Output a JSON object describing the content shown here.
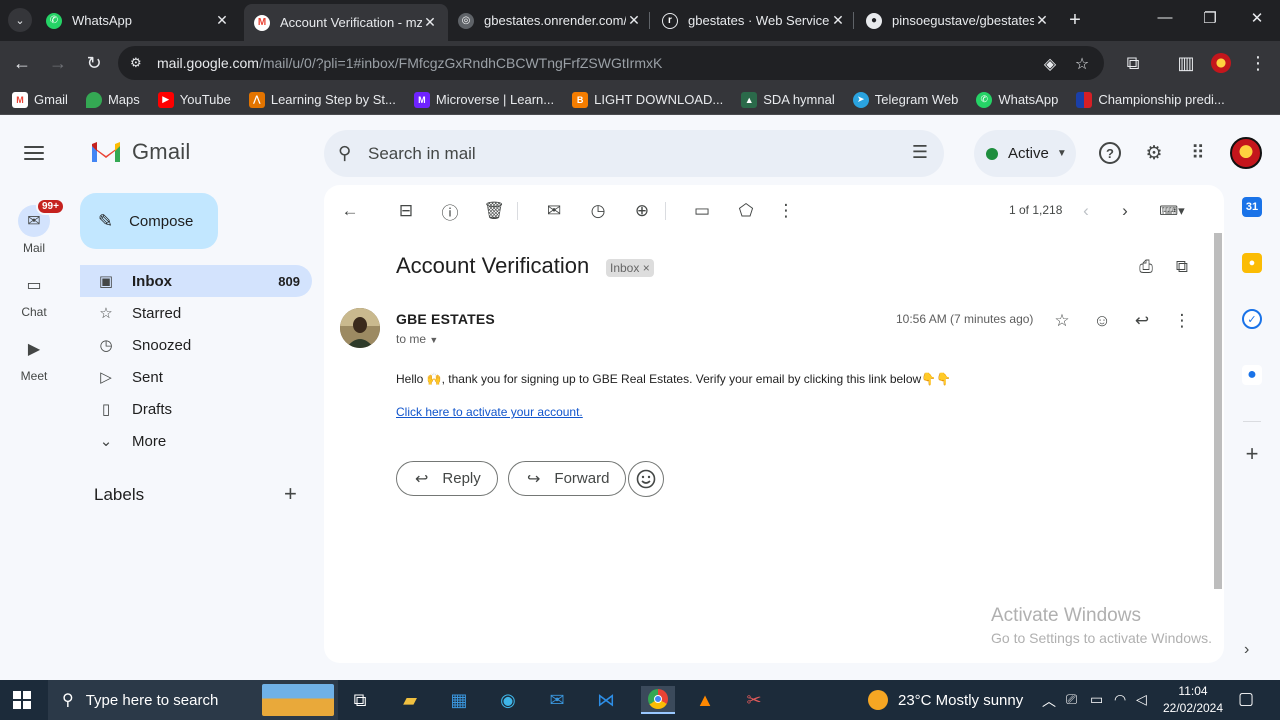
{
  "browser": {
    "tabs": [
      {
        "title": "WhatsApp",
        "favicon": "whatsapp-icon",
        "active": false
      },
      {
        "title": "Account Verification - mz",
        "favicon": "gmail-icon",
        "active": true
      },
      {
        "title": "gbestates.onrender.com/",
        "favicon": "globe-icon",
        "active": false
      },
      {
        "title": "gbestates · Web Service",
        "favicon": "render-icon",
        "active": false
      },
      {
        "title": "pinsoegustave/gbestates",
        "favicon": "github-icon",
        "active": false
      }
    ],
    "url_host": "mail.google.com",
    "url_path": "/mail/u/0/?pli=1#inbox/FMfcgzGxRndhCBCWTngFrfZSWGtIrmxK",
    "bookmarks": [
      {
        "label": "Gmail",
        "icon": "gmail-icon",
        "color": "#ea4335"
      },
      {
        "label": "Maps",
        "icon": "maps-icon",
        "color": "#34a853"
      },
      {
        "label": "YouTube",
        "icon": "youtube-icon",
        "color": "#ff0000"
      },
      {
        "label": "Learning Step by St...",
        "icon": "learning-icon",
        "color": "#e37400"
      },
      {
        "label": "Microverse | Learn...",
        "icon": "microverse-icon",
        "color": "#6f23ff"
      },
      {
        "label": "LIGHT DOWNLOAD...",
        "icon": "blogger-icon",
        "color": "#f57d00"
      },
      {
        "label": "SDA hymnal",
        "icon": "sda-icon",
        "color": "#2b6a4a"
      },
      {
        "label": "Telegram Web",
        "icon": "telegram-icon",
        "color": "#2aa3df"
      },
      {
        "label": "WhatsApp",
        "icon": "whatsapp-icon",
        "color": "#25d366"
      },
      {
        "label": "Championship predi...",
        "icon": "championship-icon",
        "color": "#1a3fa8"
      }
    ]
  },
  "gmail": {
    "brand": "Gmail",
    "search_placeholder": "Search in mail",
    "status": "Active",
    "rail": [
      {
        "label": "Mail",
        "badge": "99+"
      },
      {
        "label": "Chat"
      },
      {
        "label": "Meet"
      }
    ],
    "compose": "Compose",
    "nav": [
      {
        "label": "Inbox",
        "count": "809",
        "icon": "inbox-icon"
      },
      {
        "label": "Starred",
        "count": "",
        "icon": "star-icon"
      },
      {
        "label": "Snoozed",
        "count": "",
        "icon": "clock-icon"
      },
      {
        "label": "Sent",
        "count": "",
        "icon": "send-icon"
      },
      {
        "label": "Drafts",
        "count": "",
        "icon": "draft-icon"
      },
      {
        "label": "More",
        "count": "",
        "icon": "chevron-down-icon"
      }
    ],
    "labels_title": "Labels",
    "pager": "1 of 1,218",
    "email": {
      "subject": "Account Verification",
      "chip": "Inbox",
      "sender": "GBE ESTATES",
      "to": "to me",
      "time": "10:56 AM (7 minutes ago)",
      "body": "Hello 🙌, thank you for signing up to GBE Real Estates. Verify your email by clicking this link below👇👇",
      "link": "Click here to activate your account."
    },
    "reply": "Reply",
    "forward": "Forward",
    "watermark_title": "Activate Windows",
    "watermark_sub": "Go to Settings to activate Windows."
  },
  "taskbar": {
    "search_placeholder": "Type here to search",
    "weather": "23°C  Mostly sunny",
    "time": "11:04",
    "date": "22/02/2024"
  },
  "colors": {
    "accent": "#0b57d0",
    "compose_bg": "#c2e7ff",
    "nav_active": "#d3e3fd",
    "status_green": "#1e8e3e",
    "link": "#1155cc"
  }
}
